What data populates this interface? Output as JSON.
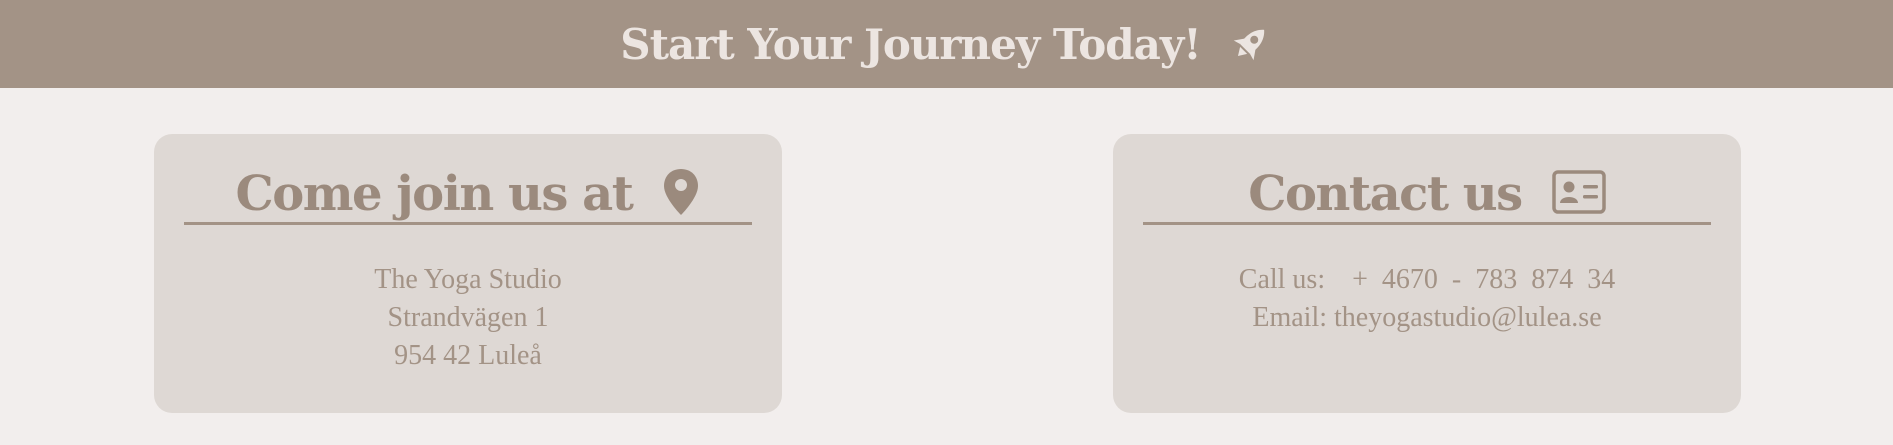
{
  "banner": {
    "title": "Start Your Journey Today!",
    "icon": "rocket-icon"
  },
  "location_card": {
    "title": "Come join us at",
    "icon": "map-pin-icon",
    "address_lines": [
      "The Yoga Studio",
      "Strandvägen 1",
      "954 42 Luleå"
    ]
  },
  "contact_card": {
    "title": "Contact us",
    "icon": "contact-card-icon",
    "phone_label": "Call us:",
    "phone_parts": [
      "+",
      "4670",
      "-",
      "783",
      "874",
      "34"
    ],
    "email_label": "Email:",
    "email": "theyogastudio@lulea.se"
  },
  "colors": {
    "background": "#f2eeed",
    "banner": "#a39386",
    "card": "#ded8d4",
    "accent": "#9b8a7d"
  }
}
